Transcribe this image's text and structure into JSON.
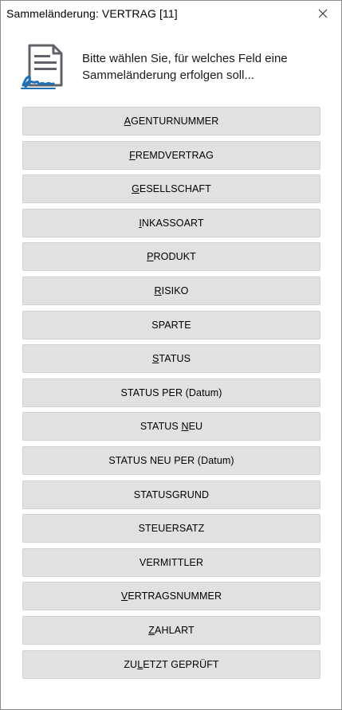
{
  "window": {
    "title": "Sammeländerung: VERTRAG [11]"
  },
  "header": {
    "prompt_line1": "Bitte wählen Sie, für welches Feld eine",
    "prompt_line2": "Sammeländerung erfolgen soll..."
  },
  "icons": {
    "close": "close-icon",
    "document": "signed-document-icon"
  },
  "colors": {
    "icon_blue": "#1f6fb5",
    "icon_gray": "#6b6b6b",
    "button_bg": "#e1e1e1"
  },
  "buttons": [
    {
      "pre": "",
      "key": "A",
      "post": "GENTURNUMMER"
    },
    {
      "pre": "",
      "key": "F",
      "post": "REMDVERTRAG"
    },
    {
      "pre": "",
      "key": "G",
      "post": "ESELLSCHAFT"
    },
    {
      "pre": "",
      "key": "I",
      "post": "NKASSOART"
    },
    {
      "pre": "",
      "key": "P",
      "post": "RODUKT"
    },
    {
      "pre": "",
      "key": "R",
      "post": "ISIKO"
    },
    {
      "pre": "SPARTE",
      "key": "",
      "post": ""
    },
    {
      "pre": "",
      "key": "S",
      "post": "TATUS"
    },
    {
      "pre": "STATUS PER (Datum)",
      "key": "",
      "post": ""
    },
    {
      "pre": "STATUS ",
      "key": "N",
      "post": "EU"
    },
    {
      "pre": "STATUS NEU PER (Datum)",
      "key": "",
      "post": ""
    },
    {
      "pre": "STATUSGRUND",
      "key": "",
      "post": ""
    },
    {
      "pre": "STEUERSATZ",
      "key": "",
      "post": ""
    },
    {
      "pre": "VERMITTLER",
      "key": "",
      "post": ""
    },
    {
      "pre": "",
      "key": "V",
      "post": "ERTRAGSNUMMER"
    },
    {
      "pre": "",
      "key": "Z",
      "post": "AHLART"
    },
    {
      "pre": "ZU",
      "key": "L",
      "post": "ETZT GEPRÜFT"
    }
  ]
}
